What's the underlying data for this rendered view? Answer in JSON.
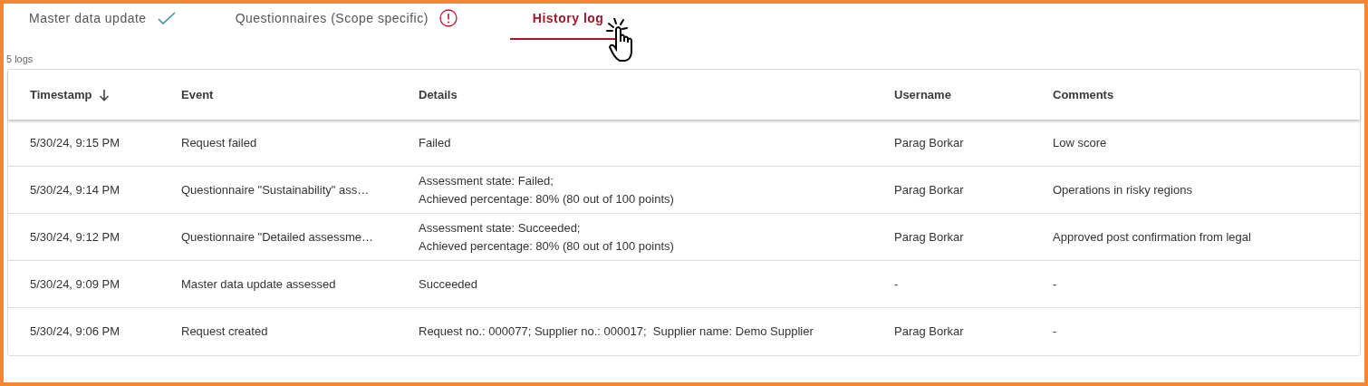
{
  "tabs": [
    {
      "label": "Master data update",
      "complete": true,
      "error": false,
      "selected": false
    },
    {
      "label": "Questionnaires (Scope specific)",
      "complete": false,
      "error": true,
      "selected": false
    },
    {
      "label": "History log",
      "complete": false,
      "error": false,
      "selected": true
    }
  ],
  "log_count": "5 logs",
  "table": {
    "columns": [
      {
        "label": "Timestamp",
        "sorted": true
      },
      {
        "label": "Event",
        "sorted": false
      },
      {
        "label": "Details",
        "sorted": false
      },
      {
        "label": "Username",
        "sorted": false
      },
      {
        "label": "Comments",
        "sorted": false
      }
    ],
    "rows": [
      {
        "timestamp": "5/30/24, 9:15 PM",
        "event": "Request failed",
        "details": [
          "Failed"
        ],
        "username": "Parag Borkar",
        "comments": "Low score"
      },
      {
        "timestamp": "5/30/24, 9:14 PM",
        "event": "Questionnaire \"Sustainability\" ass…",
        "details": [
          "Assessment state: Failed;",
          "Achieved percentage: 80% (80 out of 100 points)"
        ],
        "username": "Parag Borkar",
        "comments": "Operations in risky regions"
      },
      {
        "timestamp": "5/30/24, 9:12 PM",
        "event": "Questionnaire \"Detailed assessme…",
        "details": [
          "Assessment state: Succeeded;",
          "Achieved percentage: 80% (80 out of 100 points)"
        ],
        "username": "Parag Borkar",
        "comments": "Approved post confirmation from legal"
      },
      {
        "timestamp": "5/30/24, 9:09 PM",
        "event": "Master data update assessed",
        "details": [
          "Succeeded"
        ],
        "username": "-",
        "comments": "-"
      },
      {
        "timestamp": "5/30/24, 9:06 PM",
        "event": "Request created",
        "details": [
          "Request no.: 000077; Supplier no.: 000017;  Supplier name: Demo Supplier"
        ],
        "username": "Parag Borkar",
        "comments": "-"
      }
    ]
  }
}
